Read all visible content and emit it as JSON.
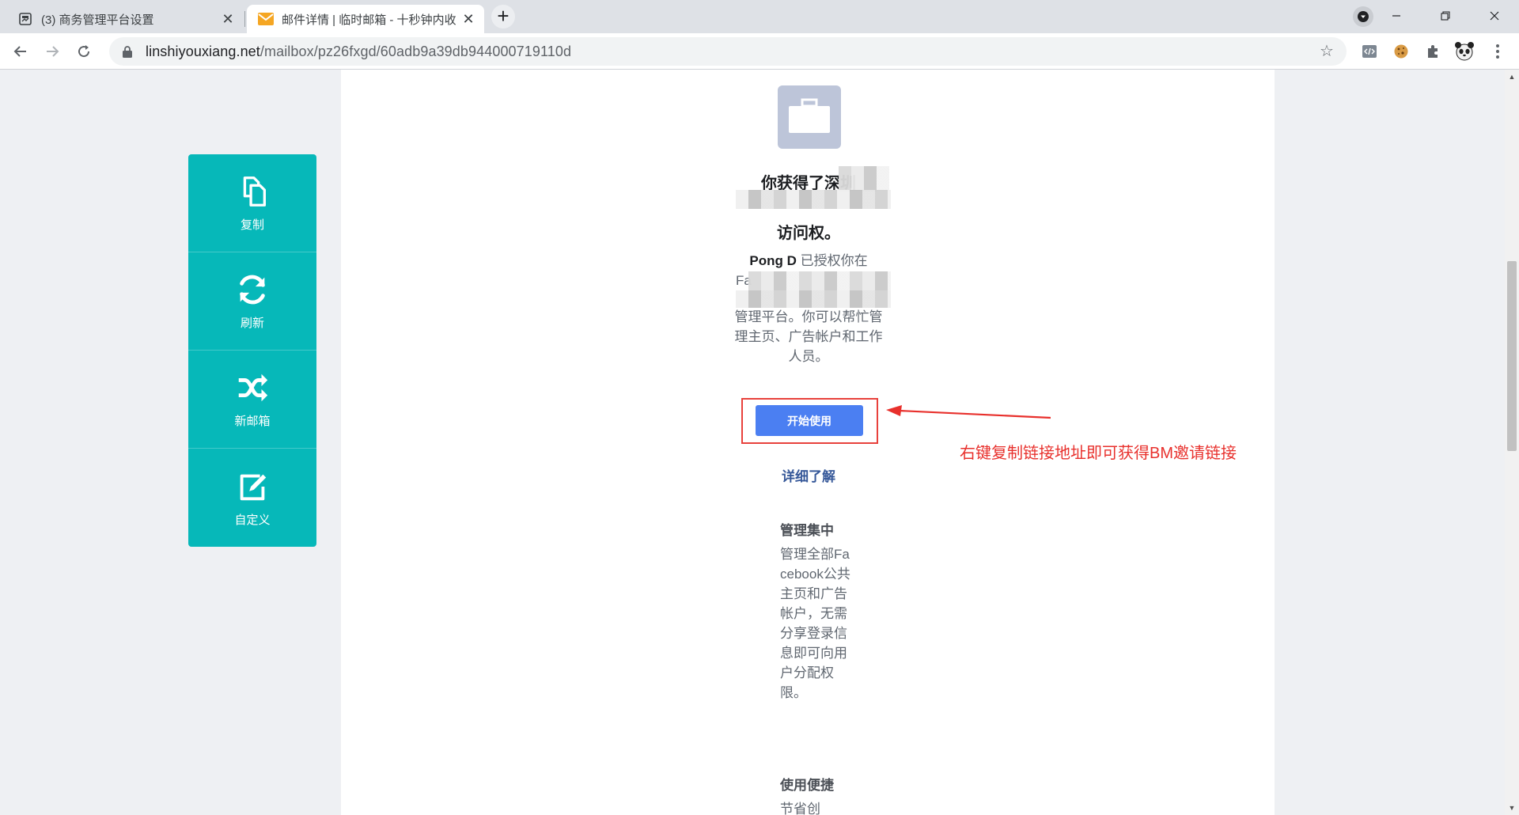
{
  "browser": {
    "tabs": [
      {
        "title": "(3) 商务管理平台设置",
        "active": false
      },
      {
        "title": "邮件详情 | 临时邮箱 - 十秒钟内收",
        "active": true
      }
    ],
    "new_tab_label": "+",
    "url": {
      "host": "linshiyouxiang.net",
      "path": "/mailbox/pz26fxgd/60adb9a39db944000719110d"
    }
  },
  "sidebar": {
    "items": [
      {
        "label": "复制",
        "icon": "copy-icon"
      },
      {
        "label": "刷新",
        "icon": "refresh-icon"
      },
      {
        "label": "新邮箱",
        "icon": "shuffle-icon"
      },
      {
        "label": "自定义",
        "icon": "edit-icon"
      }
    ]
  },
  "email": {
    "headline_line1": "你获得了深圳",
    "headline_line3": "访问权。",
    "intro_name": "Pong D",
    "intro_after_name": " 已授权你在",
    "intro_fa": "Fa",
    "intro_rest": "管理平台。你可以帮忙管理主页、广告帐户和工作人员。",
    "cta_label": "开始使用",
    "learn_more": "详细了解",
    "sections": [
      {
        "heading": "管理集中",
        "body": "管理全部Facebook公共主页和广告帐户，无需分享登录信息即可向用户分配权限。"
      },
      {
        "heading": "使用便捷",
        "body": "节省创"
      }
    ]
  },
  "annotation": {
    "text": "右键复制链接地址即可获得BM邀请链接",
    "color": "#e8302c"
  },
  "colors": {
    "sidebar": "#06b8b9",
    "cta": "#4b7ff2",
    "link": "#365899"
  }
}
